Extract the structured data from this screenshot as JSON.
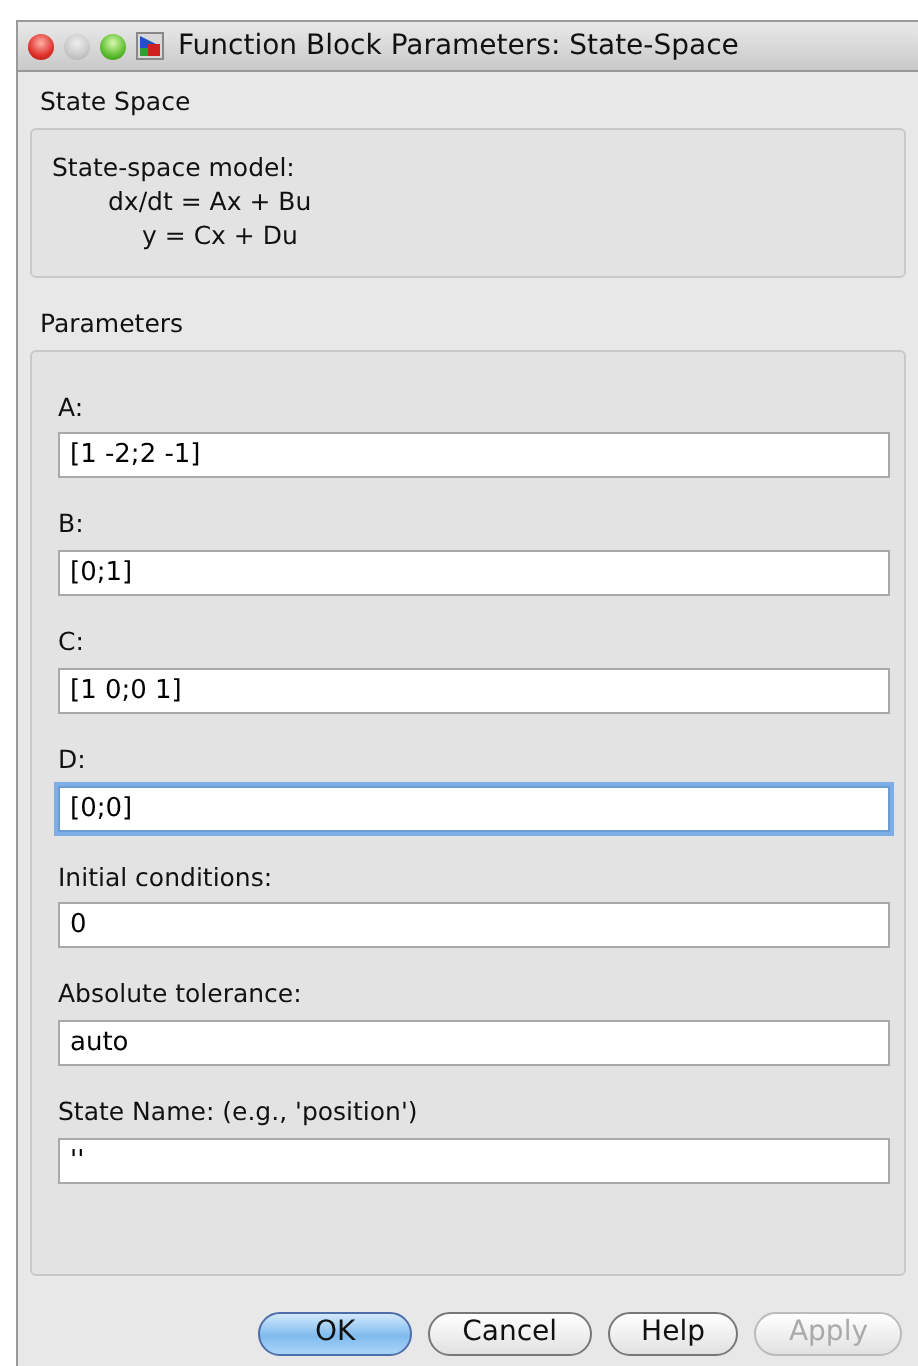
{
  "window": {
    "title": "Function Block Parameters: State-Space"
  },
  "block_name": "State Space",
  "description": [
    "State-space model:",
    "dx/dt = Ax + Bu",
    "y = Cx + Du"
  ],
  "parameters_heading": "Parameters",
  "fields": [
    {
      "label": "A:",
      "value": "[1 -2;2 -1]",
      "focused": false
    },
    {
      "label": "B:",
      "value": "[0;1]",
      "focused": false
    },
    {
      "label": "C:",
      "value": "[1 0;0 1]",
      "focused": false
    },
    {
      "label": "D:",
      "value": "[0;0]",
      "focused": true
    },
    {
      "label": "Initial conditions:",
      "value": "0",
      "focused": false
    },
    {
      "label": "Absolute tolerance:",
      "value": "auto",
      "focused": false
    },
    {
      "label": "State Name: (e.g., 'position')",
      "value": "''",
      "focused": false
    }
  ],
  "buttons": [
    {
      "label": "OK",
      "default": true,
      "disabled": false
    },
    {
      "label": "Cancel",
      "default": false,
      "disabled": false
    },
    {
      "label": "Help",
      "default": false,
      "disabled": false
    },
    {
      "label": "Apply",
      "default": false,
      "disabled": true
    }
  ]
}
